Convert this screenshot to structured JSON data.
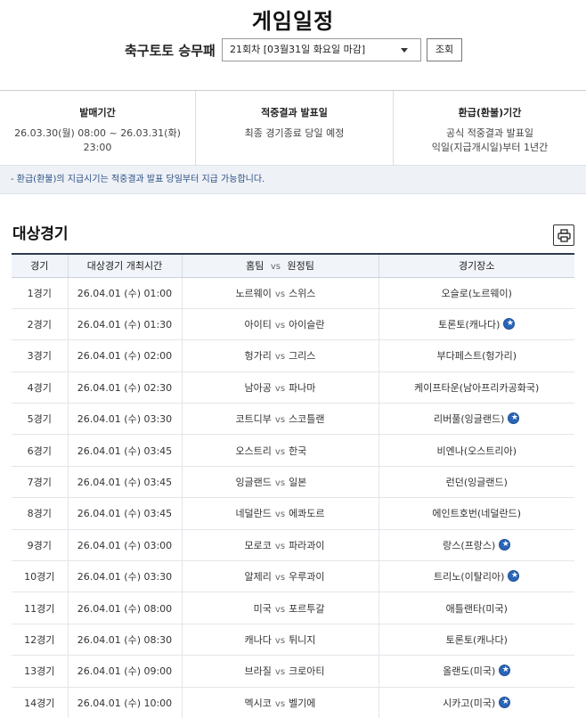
{
  "page": {
    "title": "게임일정"
  },
  "selector": {
    "label": "축구토토 승무패",
    "selected": "21회차 [03월31일 화요일 마감]",
    "button": "조회"
  },
  "info": {
    "sale_period": {
      "heading": "발매기간",
      "text": "26.03.30(월) 08:00 ~ 26.03.31(화) 23:00"
    },
    "result_date": {
      "heading": "적중결과 발표일",
      "text": "최종 경기종료 당일 예정"
    },
    "refund_period": {
      "heading": "환급(환불)기간",
      "text1": "공식 적중결과 발표일",
      "text2": "익일(지급개시일)부터 1년간"
    }
  },
  "notice": "- 환급(환불)의 지급시기는 적중결과 발표 당일부터 지급 가능합니다.",
  "section": {
    "title": "대상경기"
  },
  "table": {
    "headers": {
      "game": "경기",
      "time": "대상경기 개최시간",
      "teams_home": "홈팀",
      "teams_vs": "vs",
      "teams_away": "원정팀",
      "venue": "경기장소"
    },
    "vs": "vs",
    "rows": [
      {
        "game": "1경기",
        "time": "26.04.01 (수) 01:00",
        "home": "노르웨이",
        "away": "스위스",
        "venue": "오슬로(노르웨이)",
        "star": false
      },
      {
        "game": "2경기",
        "time": "26.04.01 (수) 01:30",
        "home": "아이티",
        "away": "아이슬란",
        "venue": "토론토(캐나다)",
        "star": true
      },
      {
        "game": "3경기",
        "time": "26.04.01 (수) 02:00",
        "home": "헝가리",
        "away": "그리스",
        "venue": "부다페스트(헝가리)",
        "star": false
      },
      {
        "game": "4경기",
        "time": "26.04.01 (수) 02:30",
        "home": "남아공",
        "away": "파나마",
        "venue": "케이프타운(남아프리카공화국)",
        "star": false
      },
      {
        "game": "5경기",
        "time": "26.04.01 (수) 03:30",
        "home": "코트디부",
        "away": "스코틀랜",
        "venue": "리버풀(잉글랜드)",
        "star": true
      },
      {
        "game": "6경기",
        "time": "26.04.01 (수) 03:45",
        "home": "오스트리",
        "away": "한국",
        "venue": "비엔나(오스트리아)",
        "star": false
      },
      {
        "game": "7경기",
        "time": "26.04.01 (수) 03:45",
        "home": "잉글랜드",
        "away": "일본",
        "venue": "런던(잉글랜드)",
        "star": false
      },
      {
        "game": "8경기",
        "time": "26.04.01 (수) 03:45",
        "home": "네덜란드",
        "away": "에콰도르",
        "venue": "에인트호번(네덜란드)",
        "star": false
      },
      {
        "game": "9경기",
        "time": "26.04.01 (수) 03:00",
        "home": "모로코",
        "away": "파라과이",
        "venue": "랑스(프랑스)",
        "star": true
      },
      {
        "game": "10경기",
        "time": "26.04.01 (수) 03:30",
        "home": "알제리",
        "away": "우루과이",
        "venue": "트리노(이탈리아)",
        "star": true
      },
      {
        "game": "11경기",
        "time": "26.04.01 (수) 08:00",
        "home": "미국",
        "away": "포르투갈",
        "venue": "애틀랜타(미국)",
        "star": false
      },
      {
        "game": "12경기",
        "time": "26.04.01 (수) 08:30",
        "home": "캐나다",
        "away": "튀니지",
        "venue": "토론토(캐나다)",
        "star": false
      },
      {
        "game": "13경기",
        "time": "26.04.01 (수) 09:00",
        "home": "브라질",
        "away": "크로아티",
        "venue": "올랜도(미국)",
        "star": true
      },
      {
        "game": "14경기",
        "time": "26.04.01 (수) 10:00",
        "home": "멕시코",
        "away": "벨기에",
        "venue": "시카고(미국)",
        "star": true
      }
    ]
  },
  "icons": {
    "print": "printer-icon",
    "dropdown": "chevron-down-icon",
    "star": "star-badge-icon"
  },
  "colors": {
    "notice_text": "#2b4f86",
    "notice_bg": "#eef1f5",
    "table_header_bg": "#f1f4f9",
    "table_header_border": "#2f3b4f",
    "star_badge": "#2a66b8"
  }
}
